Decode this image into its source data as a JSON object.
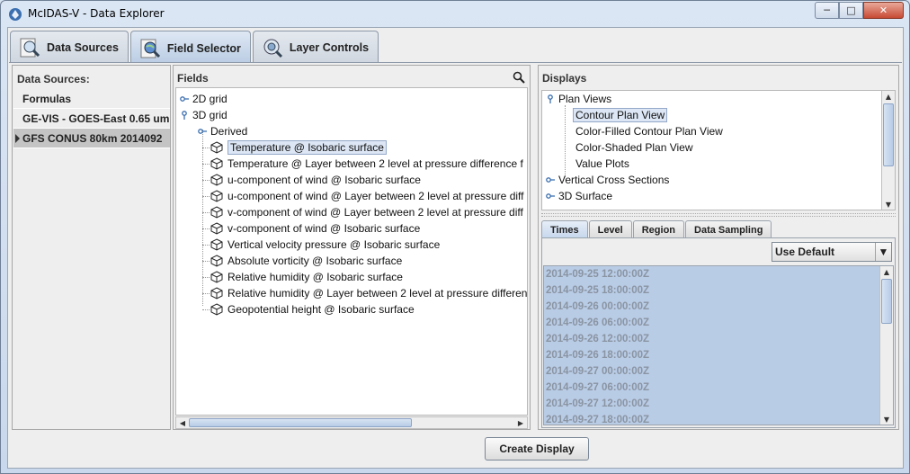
{
  "window": {
    "title": "McIDAS-V - Data Explorer"
  },
  "main_tabs": [
    {
      "label": "Data Sources",
      "icon": "magnifier-document-icon"
    },
    {
      "label": "Field Selector",
      "icon": "globe-magnifier-icon",
      "active": true
    },
    {
      "label": "Layer Controls",
      "icon": "layers-magnifier-icon"
    }
  ],
  "data_sources": {
    "header": "Data Sources:",
    "items": [
      {
        "label": "Formulas"
      },
      {
        "label": "GE-VIS - GOES-East 0.65 um"
      },
      {
        "label": "GFS CONUS 80km 2014092",
        "selected": true
      }
    ]
  },
  "fields": {
    "header": "Fields",
    "tree": [
      {
        "label": "2D grid",
        "level": 0,
        "type": "folder"
      },
      {
        "label": "3D grid",
        "level": 0,
        "type": "folder"
      },
      {
        "label": "Derived",
        "level": 1,
        "type": "folder"
      },
      {
        "label": "Temperature @ Isobaric surface",
        "level": 2,
        "type": "field",
        "selected": true
      },
      {
        "label": "Temperature @ Layer between 2 level at pressure difference f",
        "level": 2,
        "type": "field"
      },
      {
        "label": "u-component of wind @ Isobaric surface",
        "level": 2,
        "type": "field"
      },
      {
        "label": "u-component of wind @ Layer between 2 level at pressure diff",
        "level": 2,
        "type": "field"
      },
      {
        "label": "v-component of wind @ Layer between 2 level at pressure diff",
        "level": 2,
        "type": "field"
      },
      {
        "label": "v-component of wind @ Isobaric surface",
        "level": 2,
        "type": "field"
      },
      {
        "label": "Vertical velocity pressure @ Isobaric surface",
        "level": 2,
        "type": "field"
      },
      {
        "label": "Absolute vorticity @ Isobaric surface",
        "level": 2,
        "type": "field"
      },
      {
        "label": "Relative humidity @ Isobaric surface",
        "level": 2,
        "type": "field"
      },
      {
        "label": "Relative humidity @ Layer between 2 level at pressure differen",
        "level": 2,
        "type": "field"
      },
      {
        "label": "Geopotential height @ Isobaric surface",
        "level": 2,
        "type": "field"
      }
    ]
  },
  "displays": {
    "header": "Displays",
    "tree": [
      {
        "label": "Plan Views",
        "level": 0,
        "type": "folder"
      },
      {
        "label": "Contour Plan View",
        "level": 1,
        "selected": true
      },
      {
        "label": "Color-Filled Contour Plan View",
        "level": 1
      },
      {
        "label": "Color-Shaded Plan View",
        "level": 1
      },
      {
        "label": "Value Plots",
        "level": 1
      },
      {
        "label": "Vertical Cross Sections",
        "level": 0,
        "type": "folder"
      },
      {
        "label": "3D Surface",
        "level": 0,
        "type": "folder"
      }
    ],
    "subtabs": [
      "Times",
      "Level",
      "Region",
      "Data Sampling"
    ],
    "active_subtab": "Times",
    "time_mode": "Use Default",
    "times": [
      "2014-09-25 12:00:00Z",
      "2014-09-25 18:00:00Z",
      "2014-09-26 00:00:00Z",
      "2014-09-26 06:00:00Z",
      "2014-09-26 12:00:00Z",
      "2014-09-26 18:00:00Z",
      "2014-09-27 00:00:00Z",
      "2014-09-27 06:00:00Z",
      "2014-09-27 12:00:00Z",
      "2014-09-27 18:00:00Z"
    ]
  },
  "actions": {
    "create_display": "Create Display"
  },
  "colors": {
    "selection": "#dce6f4",
    "times_bg": "#b9cce6",
    "times_text": "#8a94a2"
  }
}
